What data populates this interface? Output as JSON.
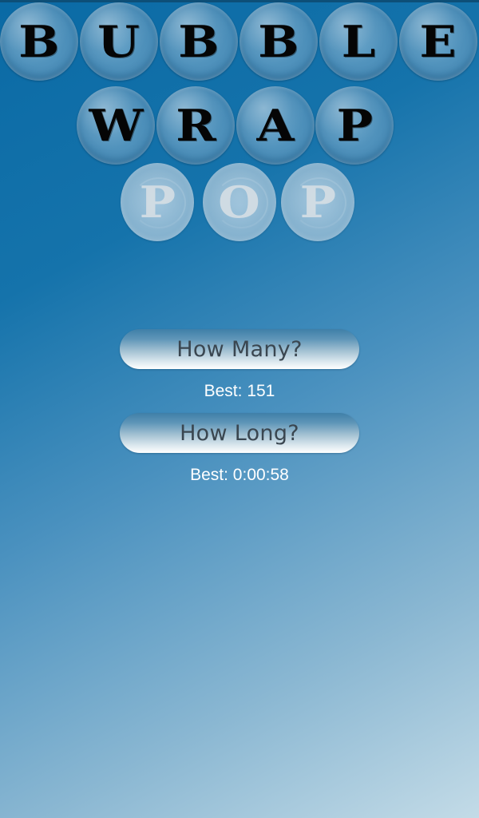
{
  "title": {
    "row1": [
      "B",
      "U",
      "B",
      "B",
      "L",
      "E"
    ],
    "row2": [
      "W",
      "R",
      "A",
      "P"
    ],
    "row3": [
      "P",
      "O",
      "P"
    ]
  },
  "menu": {
    "how_many_label": "How Many?",
    "how_many_best": "Best: 151",
    "how_long_label": "How Long?",
    "how_long_best": "Best: 0:00:58"
  },
  "colors": {
    "bubble": "#4a8db8",
    "popped_bubble": "#7eadcb",
    "letter": "#050505",
    "popped_letter": "#d6dfe5",
    "button_text": "#3a4650",
    "best_text": "#ffffff"
  }
}
